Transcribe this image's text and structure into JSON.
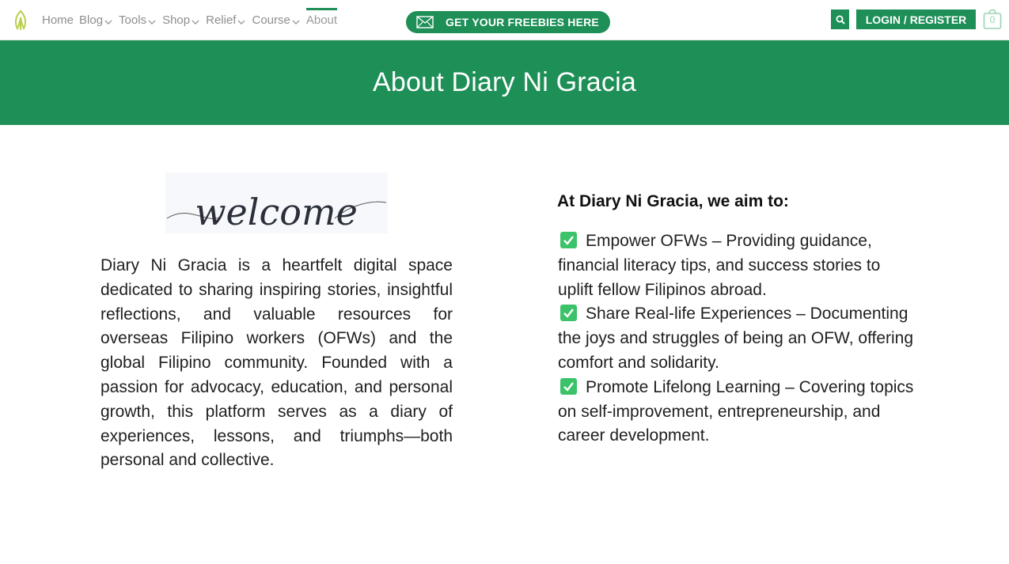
{
  "header": {
    "nav": [
      {
        "label": "Home",
        "has_dropdown": false,
        "active": false
      },
      {
        "label": "Blog",
        "has_dropdown": true,
        "active": false
      },
      {
        "label": "Tools",
        "has_dropdown": true,
        "active": false
      },
      {
        "label": "Shop",
        "has_dropdown": true,
        "active": false
      },
      {
        "label": "Relief",
        "has_dropdown": true,
        "active": false
      },
      {
        "label": "Course",
        "has_dropdown": true,
        "active": false
      },
      {
        "label": "About",
        "has_dropdown": false,
        "active": true
      }
    ],
    "freebies_label": "GET YOUR FREEBIES HERE",
    "login_label": "LOGIN / REGISTER",
    "cart_count": "0",
    "icons": {
      "logo": "leaf-logo-icon",
      "mail": "mail-icon",
      "search": "search-icon",
      "cart": "shopping-bag-icon"
    }
  },
  "hero": {
    "title": "About Diary Ni Gracia"
  },
  "left": {
    "welcome_image_text": "welcome",
    "intro": "Diary Ni Gracia is a heartfelt digital space dedicated to sharing inspiring stories, insightful reflections, and valuable resources for overseas Filipino workers (OFWs) and the global Filipino community. Founded with a passion for advocacy, education, and personal growth, this platform serves as a diary of experiences, lessons, and triumphs—both personal and collective."
  },
  "right": {
    "heading": "At Diary Ni Gracia, we aim to:",
    "aims": [
      {
        "text": "Empower OFWs – Providing guidance, financial literacy tips, and success stories to uplift fellow Filipinos abroad."
      },
      {
        "text": "Share Real-life Experiences – Documenting the joys and struggles of being an OFW, offering comfort and solidarity."
      },
      {
        "text": "Promote Lifelong Learning – Covering topics on self-improvement, entrepreneurship, and career development."
      }
    ]
  },
  "colors": {
    "brand_green": "#1e8f57",
    "check_green": "#3cc36a",
    "nav_text": "#8e8e8e"
  }
}
